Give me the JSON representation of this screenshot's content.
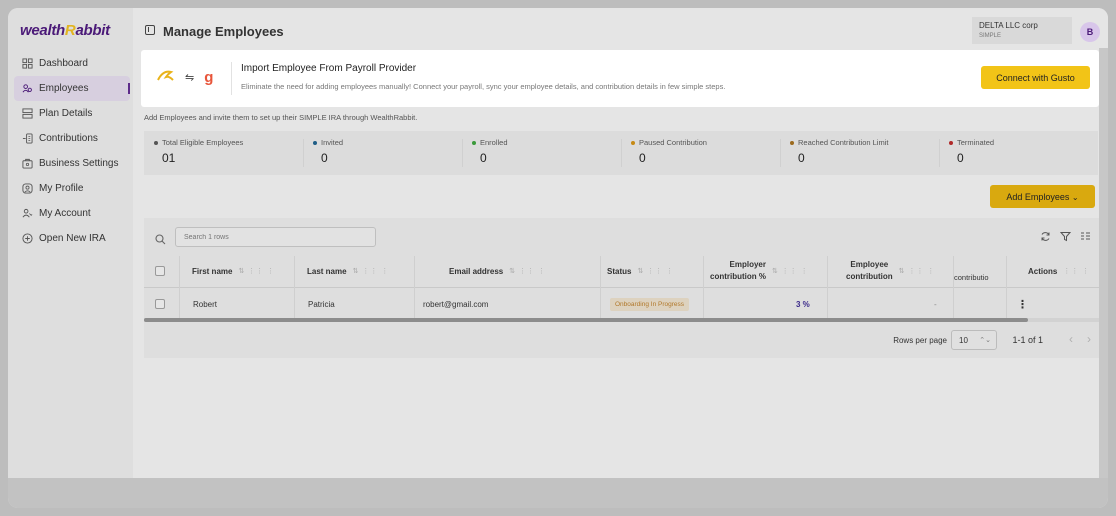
{
  "brand": {
    "logo_left": "wealth",
    "logo_r": "R",
    "logo_right": "abbit"
  },
  "sidebar": {
    "items": [
      {
        "label": "Dashboard",
        "icon": "grid-icon"
      },
      {
        "label": "Employees",
        "icon": "users-icon",
        "active": true
      },
      {
        "label": "Plan Details",
        "icon": "plan-icon"
      },
      {
        "label": "Contributions",
        "icon": "contributions-icon"
      },
      {
        "label": "Business Settings",
        "icon": "briefcase-icon"
      },
      {
        "label": "My Profile",
        "icon": "profile-icon"
      },
      {
        "label": "My Account",
        "icon": "account-icon"
      },
      {
        "label": "Open New IRA",
        "icon": "plus-circle-icon"
      }
    ]
  },
  "header": {
    "title": "Manage Employees",
    "org_name": "DELTA LLC corp",
    "org_plan": "SIMPLE",
    "avatar_initial": "B"
  },
  "banner": {
    "swap_glyph": "⇋",
    "gusto_glyph": "g",
    "title": "Import Employee From Payroll Provider",
    "subtitle": "Eliminate the need for adding employees manually! Connect your payroll, sync your employee details, and contribution details in few simple steps.",
    "button_label": "Connect with Gusto"
  },
  "intro_text": "Add Employees and invite them to set up their SIMPLE IRA through WealthRabbit.",
  "stats": [
    {
      "label": "Total Eligible Employees",
      "value": "01",
      "color": "#555555"
    },
    {
      "label": "Invited",
      "value": "0",
      "color": "#1f5e86"
    },
    {
      "label": "Enrolled",
      "value": "0",
      "color": "#3a9a3a"
    },
    {
      "label": "Paused Contribution",
      "value": "0",
      "color": "#c68a16"
    },
    {
      "label": "Reached Contribution Limit",
      "value": "0",
      "color": "#9c6a1e"
    },
    {
      "label": "Terminated",
      "value": "0",
      "color": "#b02a2a"
    }
  ],
  "add_button_label": "Add Employees",
  "search": {
    "placeholder": "Search 1 rows"
  },
  "table": {
    "headers": {
      "first_name": "First name",
      "last_name": "Last name",
      "email": "Email address",
      "status": "Status",
      "employer_pct_1": "Employer",
      "employer_pct_2": "contribution %",
      "employee_1": "Employee",
      "employee_2": "contribution",
      "contribution": "contributio",
      "actions": "Actions"
    },
    "row": {
      "first_name": "Robert",
      "last_name": "Patricia",
      "email": "robert@gmail.com",
      "status": "Onboarding In Progress",
      "employer_pct": "3 %",
      "employee_contribution": "-",
      "actions": "⋮"
    }
  },
  "footer": {
    "rows_per_page_label": "Rows per page",
    "rows_per_page_value": "10",
    "page_info": "1-1 of 1",
    "prev": "‹",
    "next": "›"
  }
}
